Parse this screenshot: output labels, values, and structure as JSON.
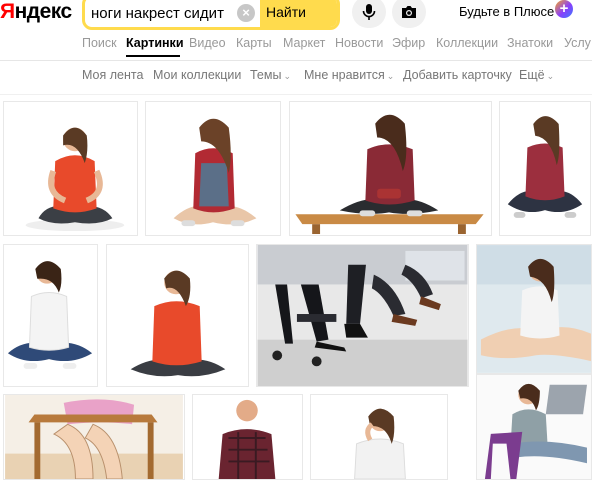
{
  "header": {
    "logo_first": "Я",
    "logo_rest": "ндекс",
    "search": {
      "value": "ноги накрест сидит",
      "submit_label": "Найти"
    },
    "plus_text": "Будьте в Плюсе",
    "plus_badge": "+"
  },
  "colors": {
    "accent_yellow": "#ffdb4d",
    "logo_red": "#ff0000",
    "tab_inactive": "#999999",
    "filter_text": "#777777"
  },
  "service_tabs": [
    {
      "label": "Поиск",
      "active": false
    },
    {
      "label": "Картинки",
      "active": true
    },
    {
      "label": "Видео",
      "active": false
    },
    {
      "label": "Карты",
      "active": false
    },
    {
      "label": "Маркет",
      "active": false
    },
    {
      "label": "Новости",
      "active": false
    },
    {
      "label": "Эфир",
      "active": false
    },
    {
      "label": "Коллекции",
      "active": false
    },
    {
      "label": "Знатоки",
      "active": false
    },
    {
      "label": "Услу",
      "active": false
    }
  ],
  "filters": [
    {
      "label": "Моя лента"
    },
    {
      "label": "Мои коллекции"
    },
    {
      "label": "Темы"
    },
    {
      "label": "Мне нравится"
    },
    {
      "label": "Добавить карточку"
    },
    {
      "label": "Ещё"
    }
  ],
  "icons": {
    "mic": "microphone-icon",
    "camera": "camera-icon",
    "clear": "clear-icon",
    "plus": "yandex-plus-icon",
    "chevron": "chevron-down-icon"
  },
  "results": [
    {
      "subject": "woman-red-top-cross-legged"
    },
    {
      "subject": "woman-plaid-shirt-overalls-cross-legged"
    },
    {
      "subject": "woman-plaid-shirt-on-bench"
    },
    {
      "subject": "woman-plaid-shirt-cross-legged"
    },
    {
      "subject": "girl-white-shirt-jeans-cross-legged"
    },
    {
      "subject": "woman-red-top-sitting"
    },
    {
      "subject": "office-legs-under-table"
    },
    {
      "subject": "woman-white-top-sitting"
    },
    {
      "subject": "illustration-legs-on-chair"
    },
    {
      "subject": "man-plaid-shirt-sitting"
    },
    {
      "subject": "woman-white-top-thinking"
    },
    {
      "subject": "woman-on-chair-with-laptop"
    }
  ]
}
